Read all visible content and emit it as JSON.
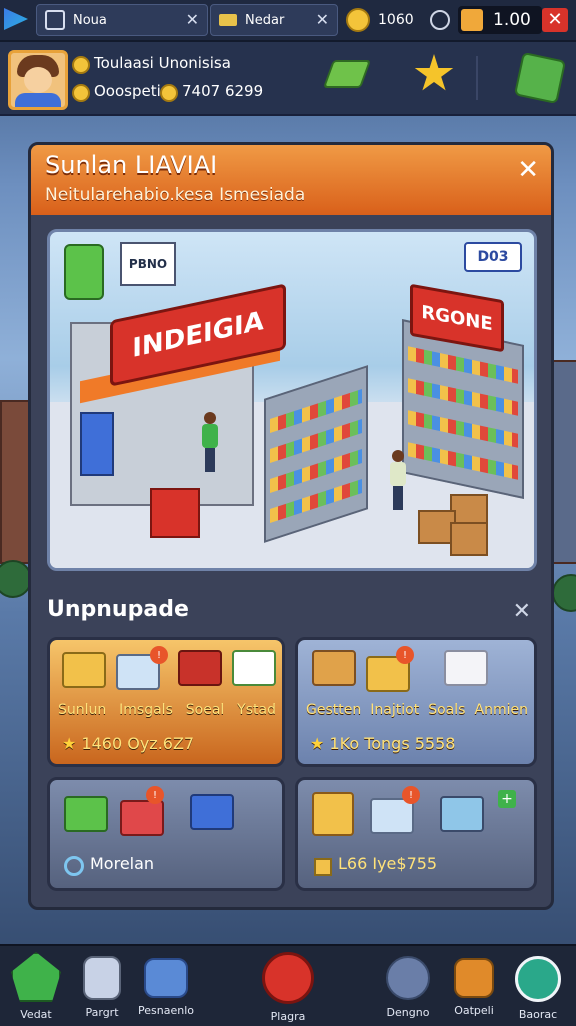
{
  "topbar": {
    "tab1_label": "Noua",
    "tab2_label": "Nedar",
    "coins_value": "1060",
    "gems_value": "1.00"
  },
  "profile": {
    "name": "Toulaasi Unonisisa",
    "stat_label": "Ooospeti",
    "stat_value": "7407 6299"
  },
  "modal": {
    "title": "Sunlan LIAVIAI",
    "subtitle": "Neitularehabio.kesa Ismesiada",
    "scene": {
      "badge": "D03",
      "sign_left": "INDEIGIA",
      "sign_right": "RGONE",
      "sign_board": "PBNO"
    },
    "section_title": "Unpnupade",
    "cards": [
      {
        "labels": [
          "Sunlun",
          "Imsgals",
          "Soeal",
          "Ystad"
        ],
        "stat": "1460 Oyz.6Z7"
      },
      {
        "labels": [
          "Gestten",
          "Inajtiot",
          "Soals",
          "Anmien"
        ],
        "stat": "1Ko Tongs 5558"
      },
      {
        "labels": [],
        "stat": "Morelan"
      },
      {
        "labels": [],
        "stat": "L66 Iye$755"
      }
    ]
  },
  "bottom_nav": [
    {
      "label": "Vedat",
      "icon": "play-icon",
      "color": "#3fb24a"
    },
    {
      "label": "Pargrt",
      "icon": "building-icon",
      "color": "#9aa6c8"
    },
    {
      "label": "Pesnaenlo",
      "icon": "monitor-icon",
      "color": "#5a8ad6"
    },
    {
      "label": "Plagra",
      "icon": "record-icon",
      "color": "#d8332a"
    },
    {
      "label": "Dengno",
      "icon": "bot-icon",
      "color": "#6a7ea8"
    },
    {
      "label": "Oatpeli",
      "icon": "box-icon",
      "color": "#e08a2a"
    },
    {
      "label": "Baorac",
      "icon": "gear-icon",
      "color": "#2aa88a"
    }
  ]
}
